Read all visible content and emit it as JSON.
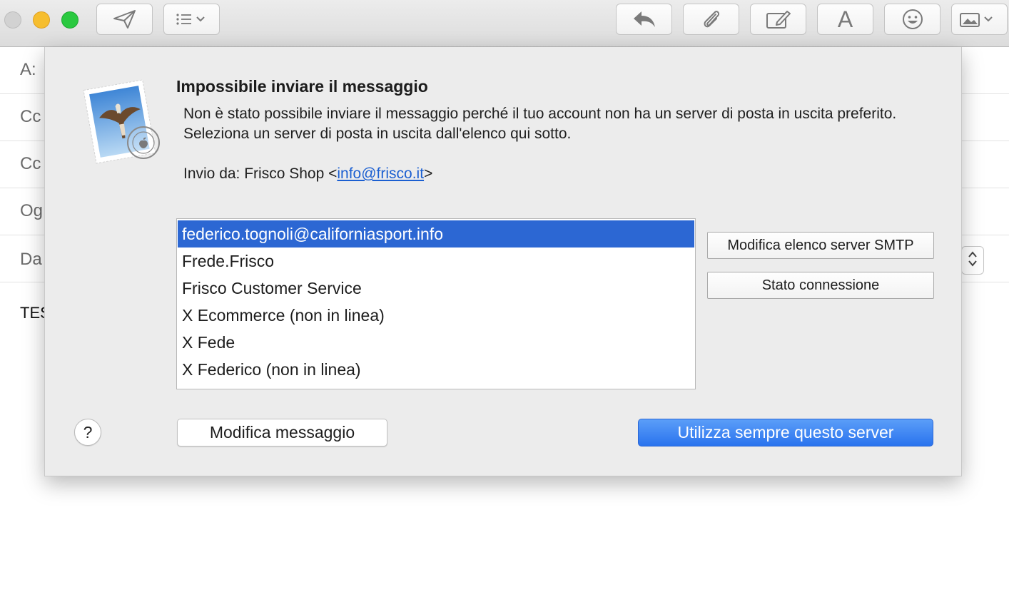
{
  "window_controls": [
    "close",
    "minimize",
    "zoom"
  ],
  "toolbar": {
    "buttons": [
      {
        "name": "send",
        "icon": "paper-plane-icon"
      },
      {
        "name": "header-fields",
        "icon": "list-chevron-icon"
      },
      {
        "name": "reply",
        "icon": "reply-arrow-icon"
      },
      {
        "name": "attach",
        "icon": "paperclip-icon"
      },
      {
        "name": "markup",
        "icon": "markup-pen-icon"
      },
      {
        "name": "format",
        "icon": "font-a-icon",
        "label": "A"
      },
      {
        "name": "emoji",
        "icon": "smiley-icon"
      },
      {
        "name": "photo",
        "icon": "photo-chevron-icon"
      }
    ]
  },
  "compose": {
    "to_label": "A:",
    "cc_label": "Cc",
    "bcc_label": "Cc",
    "subject_label": "Og",
    "from_label": "Da",
    "body_preview": "TES"
  },
  "dialog": {
    "icon": "mail-stamp-icon",
    "title": "Impossibile inviare il messaggio",
    "message": "Non è stato possibile inviare il messaggio perché il tuo account non ha un server di posta in uscita preferito. Seleziona un server di posta in uscita dall'elenco qui sotto.",
    "sending_from_prefix": "Invio da: Frisco Shop <",
    "sending_from_email": "info@frisco.it",
    "sending_from_suffix": ">",
    "servers": [
      {
        "label": "federico.tognoli@californiasport.info",
        "selected": true
      },
      {
        "label": "Frede.Frisco",
        "selected": false
      },
      {
        "label": "Frisco Customer Service",
        "selected": false
      },
      {
        "label": "X Ecommerce (non in linea)",
        "selected": false
      },
      {
        "label": "X Fede",
        "selected": false
      },
      {
        "label": "X Federico (non in linea)",
        "selected": false
      }
    ],
    "edit_smtp_button": "Modifica elenco server SMTP",
    "connection_status_button": "Stato connessione",
    "help_button": "?",
    "edit_message_button": "Modifica messaggio",
    "use_server_button": "Utilizza sempre questo server"
  },
  "colors": {
    "selection": "#2c67d3",
    "primary_button": "#2a73ee",
    "link": "#1b5fd1",
    "sheet_background": "#ececec"
  }
}
